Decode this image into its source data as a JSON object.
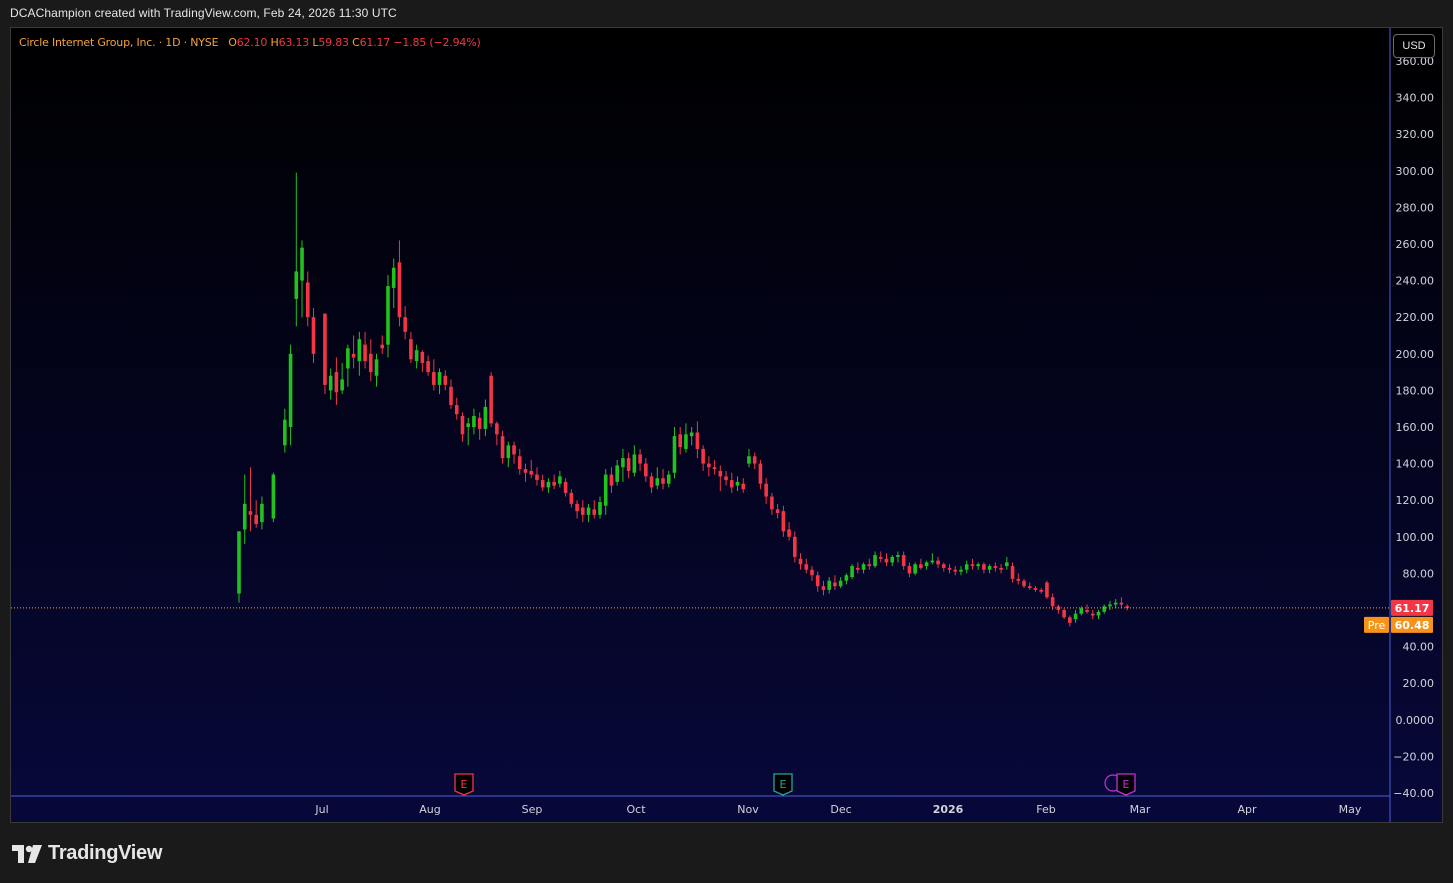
{
  "header": {
    "attribution": "DCAChampion created with TradingView.com, Feb 24, 2026 11:30 UTC"
  },
  "legend": {
    "name": "Circle Internet Group, Inc. · 1D · NYSE",
    "open_label": "O",
    "open": "62.10",
    "high_label": "H",
    "high": "63.13",
    "low_label": "L",
    "low": "59.83",
    "close_label": "C",
    "close": "61.17",
    "change": "−1.85 (−2.94%)"
  },
  "currency_button": "USD",
  "footer": {
    "brand": "TradingView"
  },
  "colors": {
    "up": "#22c21e",
    "down": "#f23645",
    "axis_text": "#d1d4dc",
    "price_line": "#f7a23b",
    "pre_label_bg": "#f7931a",
    "last_label_bg": "#f23645",
    "axis_border": "#4c5fd9"
  },
  "chart_data": {
    "type": "candlestick",
    "symbol": "Circle Internet Group, Inc.",
    "interval": "1D",
    "exchange": "NYSE",
    "y_axis": {
      "ylim": [
        -40,
        360
      ],
      "ticks": [
        "360.00",
        "340.00",
        "320.00",
        "300.00",
        "280.00",
        "260.00",
        "240.00",
        "220.00",
        "200.00",
        "180.00",
        "160.00",
        "140.00",
        "120.00",
        "100.00",
        "80.00",
        "60.00",
        "40.00",
        "20.00",
        "0.0000",
        "−20.00",
        "−40.00"
      ]
    },
    "x_axis": {
      "labels": [
        {
          "label": "Jul",
          "day": 30
        },
        {
          "label": "Aug",
          "day": 61
        },
        {
          "label": "Sep",
          "day": 92
        },
        {
          "label": "Oct",
          "day": 122
        },
        {
          "label": "Nov",
          "day": 153
        },
        {
          "label": "Dec",
          "day": 183
        },
        {
          "label": "2026",
          "day": 214
        },
        {
          "label": "Feb",
          "day": 245
        },
        {
          "label": "Mar",
          "day": 273
        },
        {
          "label": "Apr",
          "day": 304
        },
        {
          "label": "May",
          "day": 334
        }
      ],
      "day_zero": "Jun 1, 2025"
    },
    "last_price": {
      "value": 61.17,
      "label": "61.17"
    },
    "premarket": {
      "tag": "Pre",
      "value": 60.48,
      "label": "60.48"
    },
    "events": [
      {
        "type": "earnings",
        "letter": "E",
        "day": 72,
        "color": "#f23645"
      },
      {
        "type": "earnings",
        "letter": "E",
        "day": 164,
        "color": "#26a69a"
      },
      {
        "type": "earnings",
        "letter": "E",
        "day": 261,
        "color": "#c330d8",
        "extra_marker": "dividend"
      }
    ],
    "candles": [
      {
        "d": 4,
        "o": 69,
        "h": 103,
        "l": 64,
        "c": 103
      },
      {
        "d": 5,
        "o": 104,
        "h": 134,
        "l": 96,
        "c": 118
      },
      {
        "d": 6,
        "o": 114,
        "h": 138,
        "l": 103,
        "c": 112
      },
      {
        "d": 7,
        "o": 112,
        "h": 120,
        "l": 105,
        "c": 107
      },
      {
        "d": 8,
        "o": 108,
        "h": 122,
        "l": 104,
        "c": 118
      },
      {
        "d": 10,
        "o": 110,
        "h": 135,
        "l": 108,
        "c": 134
      },
      {
        "d": 12,
        "o": 150,
        "h": 170,
        "l": 146,
        "c": 164
      },
      {
        "d": 13,
        "o": 160,
        "h": 205,
        "l": 150,
        "c": 200
      },
      {
        "d": 14,
        "o": 230,
        "h": 299,
        "l": 215,
        "c": 245
      },
      {
        "d": 15,
        "o": 240,
        "h": 262,
        "l": 220,
        "c": 258
      },
      {
        "d": 16,
        "o": 239,
        "h": 245,
        "l": 215,
        "c": 220
      },
      {
        "d": 17,
        "o": 220,
        "h": 225,
        "l": 195,
        "c": 200
      },
      {
        "d": 19,
        "o": 222,
        "h": 222,
        "l": 178,
        "c": 183
      },
      {
        "d": 20,
        "o": 180,
        "h": 192,
        "l": 175,
        "c": 188
      },
      {
        "d": 21,
        "o": 190,
        "h": 198,
        "l": 172,
        "c": 179
      },
      {
        "d": 22,
        "o": 180,
        "h": 195,
        "l": 178,
        "c": 186
      },
      {
        "d": 23,
        "o": 192,
        "h": 205,
        "l": 182,
        "c": 203
      },
      {
        "d": 24,
        "o": 200,
        "h": 210,
        "l": 192,
        "c": 198
      },
      {
        "d": 25,
        "o": 196,
        "h": 212,
        "l": 188,
        "c": 208
      },
      {
        "d": 26,
        "o": 205,
        "h": 212,
        "l": 192,
        "c": 196
      },
      {
        "d": 27,
        "o": 200,
        "h": 208,
        "l": 185,
        "c": 190
      },
      {
        "d": 28,
        "o": 188,
        "h": 200,
        "l": 182,
        "c": 197
      },
      {
        "d": 29,
        "o": 205,
        "h": 210,
        "l": 200,
        "c": 203
      },
      {
        "d": 30,
        "o": 205,
        "h": 243,
        "l": 198,
        "c": 237
      },
      {
        "d": 31,
        "o": 236,
        "h": 252,
        "l": 225,
        "c": 247
      },
      {
        "d": 32,
        "o": 250,
        "h": 262,
        "l": 215,
        "c": 220
      },
      {
        "d": 33,
        "o": 220,
        "h": 226,
        "l": 208,
        "c": 212
      },
      {
        "d": 34,
        "o": 208,
        "h": 212,
        "l": 195,
        "c": 197
      },
      {
        "d": 35,
        "o": 196,
        "h": 205,
        "l": 192,
        "c": 202
      },
      {
        "d": 36,
        "o": 201,
        "h": 202,
        "l": 190,
        "c": 195
      },
      {
        "d": 37,
        "o": 196,
        "h": 199,
        "l": 188,
        "c": 190
      },
      {
        "d": 38,
        "o": 190,
        "h": 197,
        "l": 180,
        "c": 183
      },
      {
        "d": 39,
        "o": 183,
        "h": 192,
        "l": 178,
        "c": 190
      },
      {
        "d": 40,
        "o": 188,
        "h": 191,
        "l": 180,
        "c": 183
      },
      {
        "d": 41,
        "o": 182,
        "h": 186,
        "l": 170,
        "c": 172
      },
      {
        "d": 42,
        "o": 172,
        "h": 176,
        "l": 164,
        "c": 167
      },
      {
        "d": 43,
        "o": 166,
        "h": 168,
        "l": 152,
        "c": 156
      },
      {
        "d": 44,
        "o": 160,
        "h": 165,
        "l": 150,
        "c": 162
      },
      {
        "d": 45,
        "o": 160,
        "h": 170,
        "l": 156,
        "c": 166
      },
      {
        "d": 46,
        "o": 165,
        "h": 168,
        "l": 153,
        "c": 159
      },
      {
        "d": 47,
        "o": 159,
        "h": 175,
        "l": 155,
        "c": 171
      },
      {
        "d": 48,
        "o": 188,
        "h": 190,
        "l": 160,
        "c": 162
      },
      {
        "d": 49,
        "o": 162,
        "h": 163,
        "l": 150,
        "c": 156
      },
      {
        "d": 50,
        "o": 155,
        "h": 158,
        "l": 140,
        "c": 143
      },
      {
        "d": 51,
        "o": 143,
        "h": 152,
        "l": 138,
        "c": 150
      },
      {
        "d": 52,
        "o": 150,
        "h": 152,
        "l": 140,
        "c": 145
      },
      {
        "d": 53,
        "o": 144,
        "h": 148,
        "l": 134,
        "c": 137
      },
      {
        "d": 54,
        "o": 137,
        "h": 140,
        "l": 130,
        "c": 135
      },
      {
        "d": 55,
        "o": 136,
        "h": 142,
        "l": 132,
        "c": 134
      },
      {
        "d": 56,
        "o": 134,
        "h": 138,
        "l": 128,
        "c": 131
      },
      {
        "d": 57,
        "o": 131,
        "h": 134,
        "l": 125,
        "c": 127
      },
      {
        "d": 58,
        "o": 127,
        "h": 132,
        "l": 124,
        "c": 130
      },
      {
        "d": 59,
        "o": 130,
        "h": 134,
        "l": 126,
        "c": 128
      },
      {
        "d": 60,
        "o": 129,
        "h": 136,
        "l": 127,
        "c": 133
      },
      {
        "d": 61,
        "o": 130,
        "h": 132,
        "l": 122,
        "c": 124
      },
      {
        "d": 62,
        "o": 124,
        "h": 126,
        "l": 116,
        "c": 118
      },
      {
        "d": 63,
        "o": 118,
        "h": 120,
        "l": 110,
        "c": 114
      },
      {
        "d": 64,
        "o": 116,
        "h": 120,
        "l": 108,
        "c": 112
      },
      {
        "d": 65,
        "o": 112,
        "h": 118,
        "l": 108,
        "c": 116
      },
      {
        "d": 66,
        "o": 115,
        "h": 120,
        "l": 110,
        "c": 112
      },
      {
        "d": 67,
        "o": 112,
        "h": 122,
        "l": 110,
        "c": 119
      },
      {
        "d": 68,
        "o": 117,
        "h": 137,
        "l": 112,
        "c": 134
      },
      {
        "d": 69,
        "o": 134,
        "h": 138,
        "l": 124,
        "c": 128
      },
      {
        "d": 70,
        "o": 130,
        "h": 142,
        "l": 128,
        "c": 139
      },
      {
        "d": 71,
        "o": 138,
        "h": 148,
        "l": 130,
        "c": 143
      },
      {
        "d": 72,
        "o": 143,
        "h": 146,
        "l": 132,
        "c": 136
      },
      {
        "d": 73,
        "o": 135,
        "h": 150,
        "l": 133,
        "c": 145
      },
      {
        "d": 74,
        "o": 145,
        "h": 148,
        "l": 136,
        "c": 140
      },
      {
        "d": 75,
        "o": 140,
        "h": 143,
        "l": 130,
        "c": 133
      },
      {
        "d": 76,
        "o": 133,
        "h": 135,
        "l": 124,
        "c": 127
      },
      {
        "d": 77,
        "o": 128,
        "h": 138,
        "l": 126,
        "c": 132
      },
      {
        "d": 78,
        "o": 132,
        "h": 137,
        "l": 126,
        "c": 129
      },
      {
        "d": 79,
        "o": 129,
        "h": 136,
        "l": 127,
        "c": 134
      },
      {
        "d": 80,
        "o": 135,
        "h": 160,
        "l": 132,
        "c": 155
      },
      {
        "d": 81,
        "o": 156,
        "h": 160,
        "l": 145,
        "c": 149
      },
      {
        "d": 82,
        "o": 148,
        "h": 162,
        "l": 146,
        "c": 156
      },
      {
        "d": 83,
        "o": 155,
        "h": 160,
        "l": 150,
        "c": 157
      },
      {
        "d": 84,
        "o": 157,
        "h": 163,
        "l": 143,
        "c": 148
      },
      {
        "d": 85,
        "o": 148,
        "h": 150,
        "l": 136,
        "c": 140
      },
      {
        "d": 86,
        "o": 140,
        "h": 144,
        "l": 133,
        "c": 138
      },
      {
        "d": 87,
        "o": 138,
        "h": 142,
        "l": 134,
        "c": 137
      },
      {
        "d": 88,
        "o": 136,
        "h": 139,
        "l": 125,
        "c": 133
      },
      {
        "d": 89,
        "o": 133,
        "h": 136,
        "l": 128,
        "c": 131
      },
      {
        "d": 90,
        "o": 131,
        "h": 135,
        "l": 124,
        "c": 127
      },
      {
        "d": 91,
        "o": 128,
        "h": 133,
        "l": 125,
        "c": 130
      },
      {
        "d": 92,
        "o": 129,
        "h": 132,
        "l": 124,
        "c": 126
      },
      {
        "d": 93,
        "o": 140,
        "h": 148,
        "l": 138,
        "c": 144
      },
      {
        "d": 94,
        "o": 144,
        "h": 146,
        "l": 137,
        "c": 140
      },
      {
        "d": 95,
        "o": 140,
        "h": 142,
        "l": 126,
        "c": 129
      },
      {
        "d": 96,
        "o": 129,
        "h": 132,
        "l": 118,
        "c": 122
      },
      {
        "d": 97,
        "o": 122,
        "h": 124,
        "l": 112,
        "c": 115
      },
      {
        "d": 98,
        "o": 115,
        "h": 118,
        "l": 110,
        "c": 113
      },
      {
        "d": 99,
        "o": 114,
        "h": 117,
        "l": 100,
        "c": 103
      },
      {
        "d": 100,
        "o": 104,
        "h": 108,
        "l": 98,
        "c": 100
      },
      {
        "d": 101,
        "o": 100,
        "h": 103,
        "l": 86,
        "c": 89
      },
      {
        "d": 102,
        "o": 88,
        "h": 91,
        "l": 82,
        "c": 85
      },
      {
        "d": 103,
        "o": 85,
        "h": 88,
        "l": 80,
        "c": 82
      },
      {
        "d": 104,
        "o": 82,
        "h": 84,
        "l": 76,
        "c": 79
      },
      {
        "d": 105,
        "o": 79,
        "h": 81,
        "l": 70,
        "c": 73
      },
      {
        "d": 106,
        "o": 73,
        "h": 76,
        "l": 68,
        "c": 71
      },
      {
        "d": 107,
        "o": 71,
        "h": 78,
        "l": 69,
        "c": 76
      },
      {
        "d": 108,
        "o": 75,
        "h": 79,
        "l": 71,
        "c": 73
      },
      {
        "d": 109,
        "o": 73,
        "h": 78,
        "l": 72,
        "c": 76
      },
      {
        "d": 110,
        "o": 76,
        "h": 80,
        "l": 74,
        "c": 79
      },
      {
        "d": 111,
        "o": 78,
        "h": 85,
        "l": 77,
        "c": 84
      },
      {
        "d": 112,
        "o": 83,
        "h": 86,
        "l": 80,
        "c": 82
      },
      {
        "d": 113,
        "o": 82,
        "h": 86,
        "l": 80,
        "c": 85
      },
      {
        "d": 114,
        "o": 85,
        "h": 88,
        "l": 82,
        "c": 84
      },
      {
        "d": 115,
        "o": 84,
        "h": 92,
        "l": 83,
        "c": 90
      },
      {
        "d": 116,
        "o": 89,
        "h": 92,
        "l": 86,
        "c": 88
      },
      {
        "d": 117,
        "o": 88,
        "h": 91,
        "l": 84,
        "c": 86
      },
      {
        "d": 118,
        "o": 86,
        "h": 90,
        "l": 84,
        "c": 89
      },
      {
        "d": 119,
        "o": 89,
        "h": 92,
        "l": 86,
        "c": 90
      },
      {
        "d": 120,
        "o": 90,
        "h": 92,
        "l": 82,
        "c": 84
      },
      {
        "d": 121,
        "o": 84,
        "h": 86,
        "l": 78,
        "c": 80
      },
      {
        "d": 122,
        "o": 80,
        "h": 86,
        "l": 79,
        "c": 85
      },
      {
        "d": 123,
        "o": 85,
        "h": 88,
        "l": 82,
        "c": 83
      },
      {
        "d": 124,
        "o": 84,
        "h": 87,
        "l": 82,
        "c": 86
      },
      {
        "d": 125,
        "o": 86,
        "h": 91,
        "l": 85,
        "c": 87
      },
      {
        "d": 126,
        "o": 87,
        "h": 89,
        "l": 83,
        "c": 85
      },
      {
        "d": 127,
        "o": 85,
        "h": 86,
        "l": 81,
        "c": 83
      },
      {
        "d": 128,
        "o": 83,
        "h": 85,
        "l": 80,
        "c": 82
      },
      {
        "d": 129,
        "o": 82,
        "h": 84,
        "l": 79,
        "c": 81
      },
      {
        "d": 130,
        "o": 81,
        "h": 84,
        "l": 79,
        "c": 82
      },
      {
        "d": 131,
        "o": 82,
        "h": 87,
        "l": 80,
        "c": 85
      },
      {
        "d": 132,
        "o": 85,
        "h": 88,
        "l": 82,
        "c": 84
      },
      {
        "d": 133,
        "o": 84,
        "h": 86,
        "l": 82,
        "c": 85
      },
      {
        "d": 134,
        "o": 85,
        "h": 86,
        "l": 80,
        "c": 82
      },
      {
        "d": 135,
        "o": 82,
        "h": 85,
        "l": 80,
        "c": 84
      },
      {
        "d": 136,
        "o": 84,
        "h": 86,
        "l": 81,
        "c": 83
      },
      {
        "d": 137,
        "o": 83,
        "h": 85,
        "l": 80,
        "c": 82
      },
      {
        "d": 138,
        "o": 84,
        "h": 89,
        "l": 82,
        "c": 86
      },
      {
        "d": 139,
        "o": 84,
        "h": 86,
        "l": 75,
        "c": 77
      },
      {
        "d": 140,
        "o": 77,
        "h": 80,
        "l": 74,
        "c": 76
      },
      {
        "d": 141,
        "o": 76,
        "h": 77,
        "l": 72,
        "c": 73
      },
      {
        "d": 142,
        "o": 73,
        "h": 75,
        "l": 71,
        "c": 72
      },
      {
        "d": 143,
        "o": 72,
        "h": 73,
        "l": 70,
        "c": 71
      },
      {
        "d": 144,
        "o": 71,
        "h": 72,
        "l": 69,
        "c": 70
      },
      {
        "d": 145,
        "o": 75,
        "h": 76,
        "l": 66,
        "c": 67
      },
      {
        "d": 146,
        "o": 67,
        "h": 69,
        "l": 60,
        "c": 62
      },
      {
        "d": 147,
        "o": 62,
        "h": 63,
        "l": 58,
        "c": 60
      },
      {
        "d": 148,
        "o": 60,
        "h": 61,
        "l": 55,
        "c": 56
      },
      {
        "d": 149,
        "o": 56,
        "h": 57,
        "l": 51,
        "c": 53
      },
      {
        "d": 150,
        "o": 55,
        "h": 60,
        "l": 53,
        "c": 58
      },
      {
        "d": 151,
        "o": 58,
        "h": 62,
        "l": 57,
        "c": 61
      },
      {
        "d": 152,
        "o": 60,
        "h": 63,
        "l": 58,
        "c": 59
      },
      {
        "d": 153,
        "o": 58,
        "h": 60,
        "l": 55,
        "c": 57
      },
      {
        "d": 154,
        "o": 57,
        "h": 60,
        "l": 55,
        "c": 59
      },
      {
        "d": 155,
        "o": 59,
        "h": 63,
        "l": 58,
        "c": 62
      },
      {
        "d": 156,
        "o": 62,
        "h": 65,
        "l": 60,
        "c": 63
      },
      {
        "d": 157,
        "o": 63,
        "h": 66,
        "l": 61,
        "c": 64
      },
      {
        "d": 158,
        "o": 64,
        "h": 67,
        "l": 61,
        "c": 63
      },
      {
        "d": 159,
        "o": 62.1,
        "h": 63.13,
        "l": 59.83,
        "c": 61.17
      }
    ],
    "candle_day_map": "each candle's d is an index into trading days; see note in x_axis"
  }
}
